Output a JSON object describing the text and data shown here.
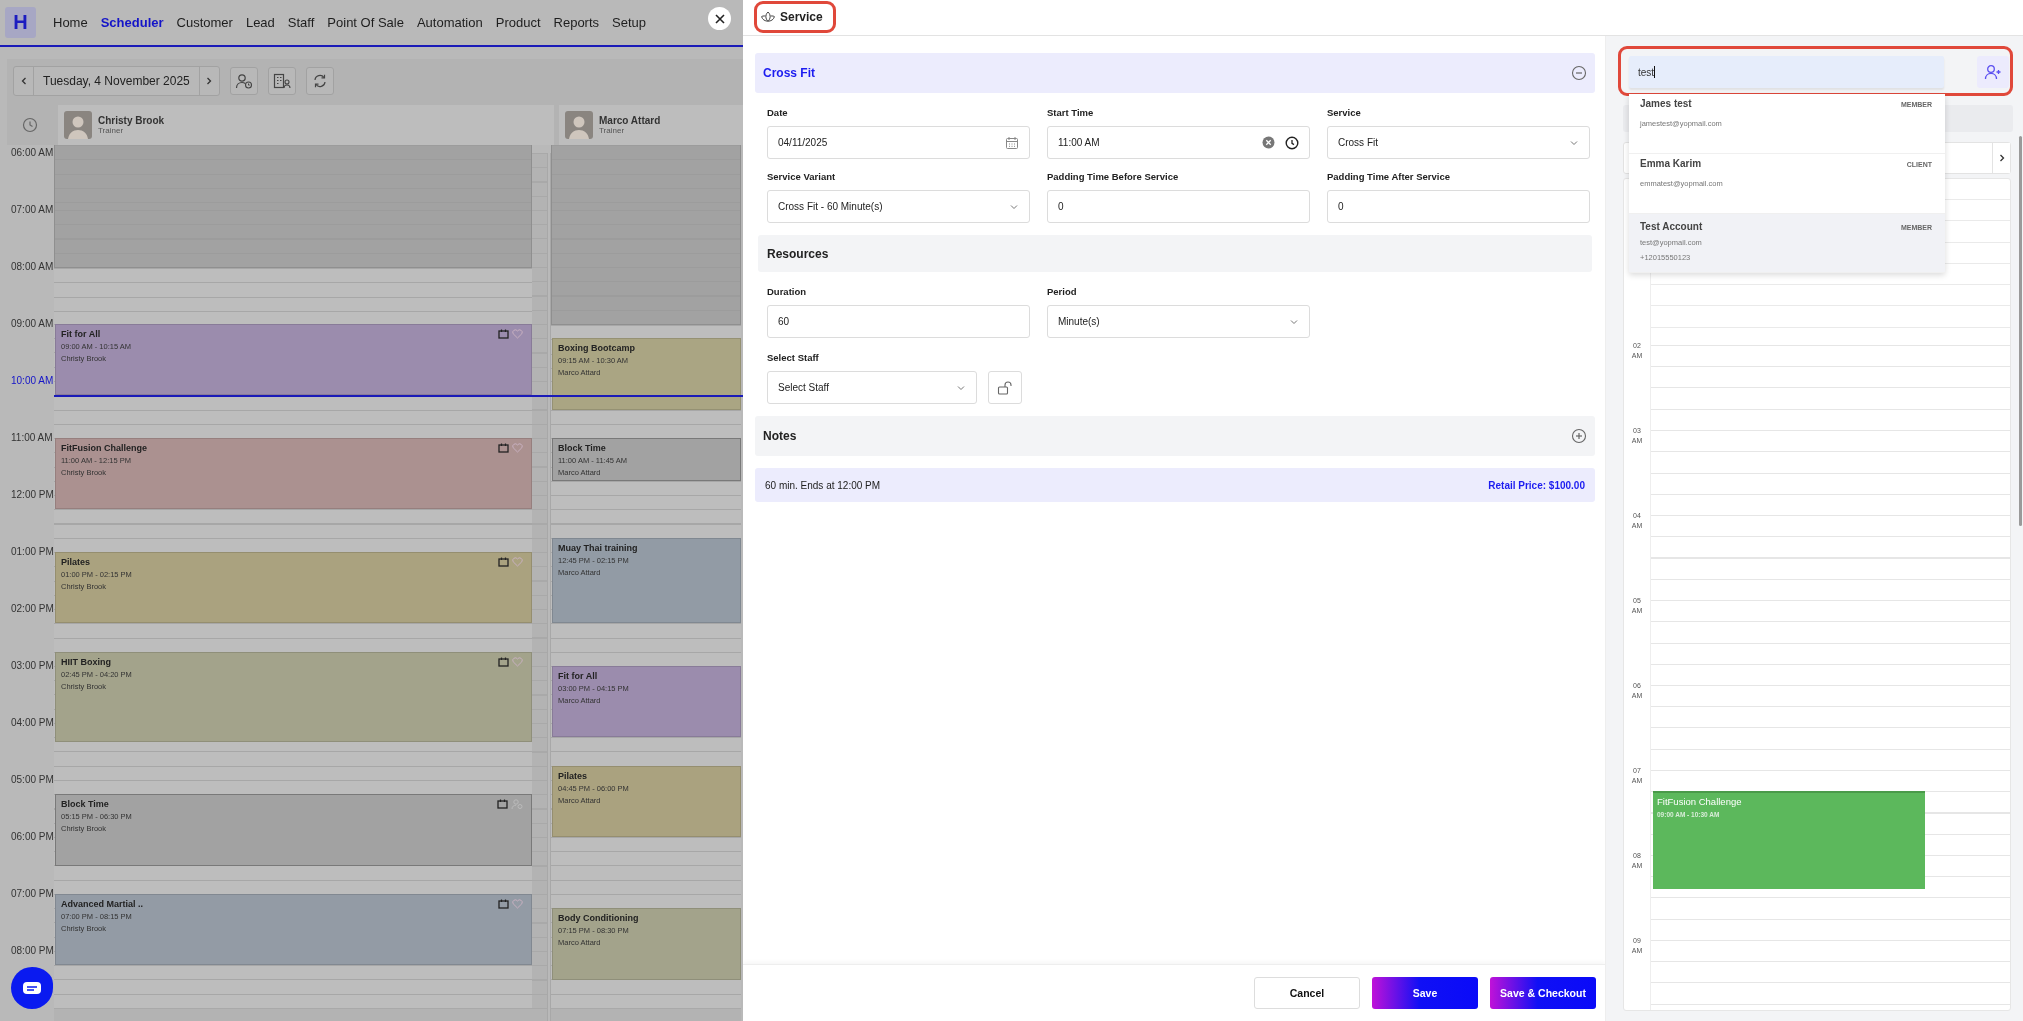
{
  "nav": {
    "logo": "H",
    "items": [
      {
        "label": "Home",
        "selected": false
      },
      {
        "label": "Scheduler",
        "selected": true
      },
      {
        "label": "Customer",
        "selected": false
      },
      {
        "label": "Lead",
        "selected": false
      },
      {
        "label": "Staff",
        "selected": false
      },
      {
        "label": "Point Of Sale",
        "selected": false
      },
      {
        "label": "Automation",
        "selected": false
      },
      {
        "label": "Product",
        "selected": false
      },
      {
        "label": "Reports",
        "selected": false
      },
      {
        "label": "Setup",
        "selected": false
      }
    ]
  },
  "toolbar": {
    "date": "Tuesday, 4 November 2025"
  },
  "times": [
    {
      "label": "06:00 AM",
      "current": false
    },
    {
      "label": "07:00 AM",
      "current": false
    },
    {
      "label": "08:00 AM",
      "current": false
    },
    {
      "label": "09:00 AM",
      "current": false
    },
    {
      "label": "10:00 AM",
      "current": true
    },
    {
      "label": "11:00 AM",
      "current": false
    },
    {
      "label": "12:00 PM",
      "current": false
    },
    {
      "label": "01:00 PM",
      "current": false
    },
    {
      "label": "02:00 PM",
      "current": false
    },
    {
      "label": "03:00 PM",
      "current": false
    },
    {
      "label": "04:00 PM",
      "current": false
    },
    {
      "label": "05:00 PM",
      "current": false
    },
    {
      "label": "06:00 PM",
      "current": false
    },
    {
      "label": "07:00 PM",
      "current": false
    },
    {
      "label": "08:00 PM",
      "current": false
    }
  ],
  "staff": [
    {
      "name": "Christy Brook",
      "role": "Trainer",
      "clipped": false,
      "hours": [
        {
          "blocked": true
        },
        {
          "blocked": true
        },
        {
          "blocked": false
        },
        {
          "blocked": false
        },
        {
          "blocked": false
        },
        {
          "blocked": false
        },
        {
          "blocked": false
        },
        {
          "blocked": false
        },
        {
          "blocked": false
        },
        {
          "blocked": false
        },
        {
          "blocked": false
        },
        {
          "blocked": false
        },
        {
          "blocked": false
        },
        {
          "blocked": false
        },
        {
          "blocked": false
        }
      ],
      "events": [
        {
          "title": "Fit for All",
          "time": "09:00 AM - 10:15 AM",
          "person": "Christy Brook",
          "kind": "class",
          "color": "#9b8cad"
        },
        {
          "title": "FitFusion Challenge",
          "time": "11:00 AM - 12:15 PM",
          "person": "Christy Brook",
          "kind": "class",
          "color": "#ab9190"
        },
        {
          "title": "Pilates",
          "time": "01:00 PM - 02:15 PM",
          "person": "Christy Brook",
          "kind": "class",
          "color": "#aaa27f"
        },
        {
          "title": "HIIT Boxing",
          "time": "02:45 PM - 04:20 PM",
          "person": "Christy Brook",
          "kind": "class",
          "color": "#a3a38b"
        },
        {
          "title": "Block Time",
          "time": "05:15 PM - 06:30 PM",
          "person": "Christy Brook",
          "kind": "block",
          "color": "#a2a2a2"
        },
        {
          "title": "Advanced Martial ..",
          "time": "07:00 PM - 08:15 PM",
          "person": "Christy Brook",
          "kind": "class",
          "color": "#939ba5"
        }
      ]
    },
    {
      "name": "Marco Attard",
      "role": "Trainer",
      "clipped": true,
      "hours": [
        {
          "blocked": true
        },
        {
          "blocked": true
        },
        {
          "blocked": true
        },
        {
          "blocked": false
        },
        {
          "blocked": false
        },
        {
          "blocked": false
        },
        {
          "blocked": false
        },
        {
          "blocked": false
        },
        {
          "blocked": false
        },
        {
          "blocked": false
        },
        {
          "blocked": false
        },
        {
          "blocked": false
        },
        {
          "blocked": false
        },
        {
          "blocked": false
        },
        {
          "blocked": false
        }
      ],
      "events": [
        {
          "title": "Boxing Bootcamp",
          "time": "09:15 AM - 10:30 AM",
          "person": "Marco Attard",
          "kind": "class",
          "color": "#aaa583"
        },
        {
          "title": "Block Time",
          "time": "11:00 AM - 11:45 AM",
          "person": "Marco Attard",
          "kind": "block",
          "color": "#a2a2a2"
        },
        {
          "title": "Muay Thai training",
          "time": "12:45 PM - 02:15 PM",
          "person": "Marco Attard",
          "kind": "class",
          "color": "#929ba5"
        },
        {
          "title": "Fit for All",
          "time": "03:00 PM - 04:15 PM",
          "person": "Marco Attard",
          "kind": "class",
          "color": "#9b8cad"
        },
        {
          "title": "Pilates",
          "time": "04:45 PM - 06:00 PM",
          "person": "Marco Attard",
          "kind": "class",
          "color": "#aaa27f"
        },
        {
          "title": "Body Conditioning",
          "time": "07:15 PM - 08:30 PM",
          "person": "Marco Attard",
          "kind": "class",
          "color": "#a3a38b"
        }
      ]
    }
  ],
  "drawer": {
    "title": "Service"
  },
  "form": {
    "section": {
      "title": "Cross Fit",
      "expanded": true
    },
    "fields": [
      {
        "label": "Date",
        "value": "04/11/2025",
        "kind": "date"
      },
      {
        "label": "Start Time",
        "value": "11:00 AM",
        "kind": "time"
      },
      {
        "label": "Service",
        "value": "Cross Fit",
        "kind": "select"
      },
      {
        "label": "Service Variant",
        "value": "Cross Fit - 60 Minute(s)",
        "kind": "select"
      },
      {
        "label": "Padding Time Before Service",
        "value": "0",
        "kind": "text"
      },
      {
        "label": "Padding Time After Service",
        "value": "0",
        "kind": "text"
      }
    ],
    "resources": {
      "title": "Resources",
      "fields": [
        {
          "label": "Duration",
          "value": "60",
          "kind": "text"
        },
        {
          "label": "Period",
          "value": "Minute(s)",
          "kind": "select"
        }
      ]
    },
    "staff_select": {
      "label": "Select Staff",
      "placeholder": "Select Staff"
    },
    "notes": {
      "title": "Notes",
      "expanded": false
    },
    "summary": {
      "text": "60 min. Ends at 12:00 PM",
      "price": "Retail Price: $100.00"
    },
    "buttons": [
      {
        "label": "Cancel",
        "kind": "secondary"
      },
      {
        "label": "Save",
        "kind": "primary"
      },
      {
        "label": "Save & Checkout",
        "kind": "primary"
      }
    ]
  },
  "customer_search": {
    "value": "test",
    "results": [
      {
        "name": "James test",
        "tag": "MEMBER",
        "email": "jamestest@yopmail.com",
        "selected": false
      },
      {
        "name": "Emma Karim",
        "tag": "CLIENT",
        "email": "emmatest@yopmail.com",
        "selected": false
      },
      {
        "name": "Test Account",
        "tag": "MEMBER",
        "email": "test@yopmail.com",
        "phone": "+12015550123",
        "selected": true
      }
    ]
  },
  "mini_calendar": {
    "hours": [
      {
        "label": "02 AM"
      },
      {
        "label": "03 AM"
      },
      {
        "label": "04 AM"
      },
      {
        "label": "05 AM"
      },
      {
        "label": "06 AM"
      },
      {
        "label": "07 AM",
        "events": [
          {
            "title": "FitFusion Challenge",
            "time": "09:00 AM - 10:30 AM"
          }
        ]
      },
      {
        "label": "08 AM"
      },
      {
        "label": "09 AM"
      }
    ]
  }
}
